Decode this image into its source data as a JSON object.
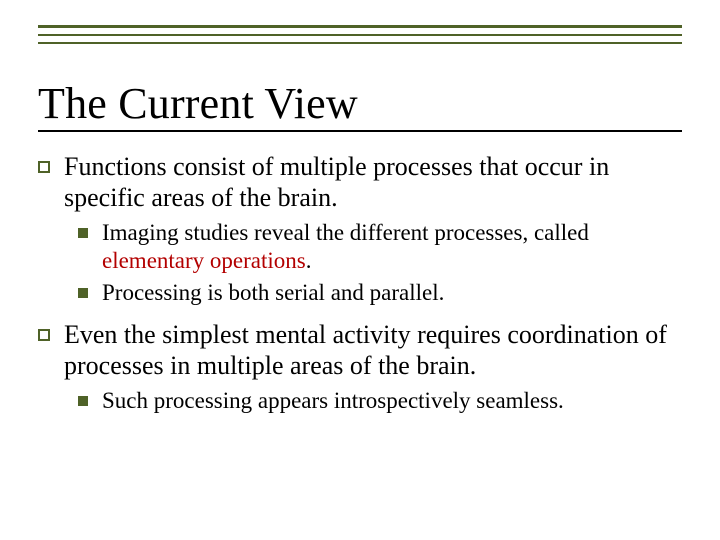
{
  "title": "The Current View",
  "items": [
    {
      "text": "Functions consist of multiple processes that occur in specific areas of the brain.",
      "sub": [
        {
          "pre": "Imaging studies reveal the different processes, called ",
          "em": "elementary operations",
          "post": "."
        },
        {
          "pre": "Processing is both serial and parallel.",
          "em": "",
          "post": ""
        }
      ]
    },
    {
      "text": "Even the simplest mental activity requires coordination of processes in multiple areas of the brain.",
      "sub": [
        {
          "pre": "Such processing appears introspectively seamless.",
          "em": "",
          "post": ""
        }
      ]
    }
  ]
}
